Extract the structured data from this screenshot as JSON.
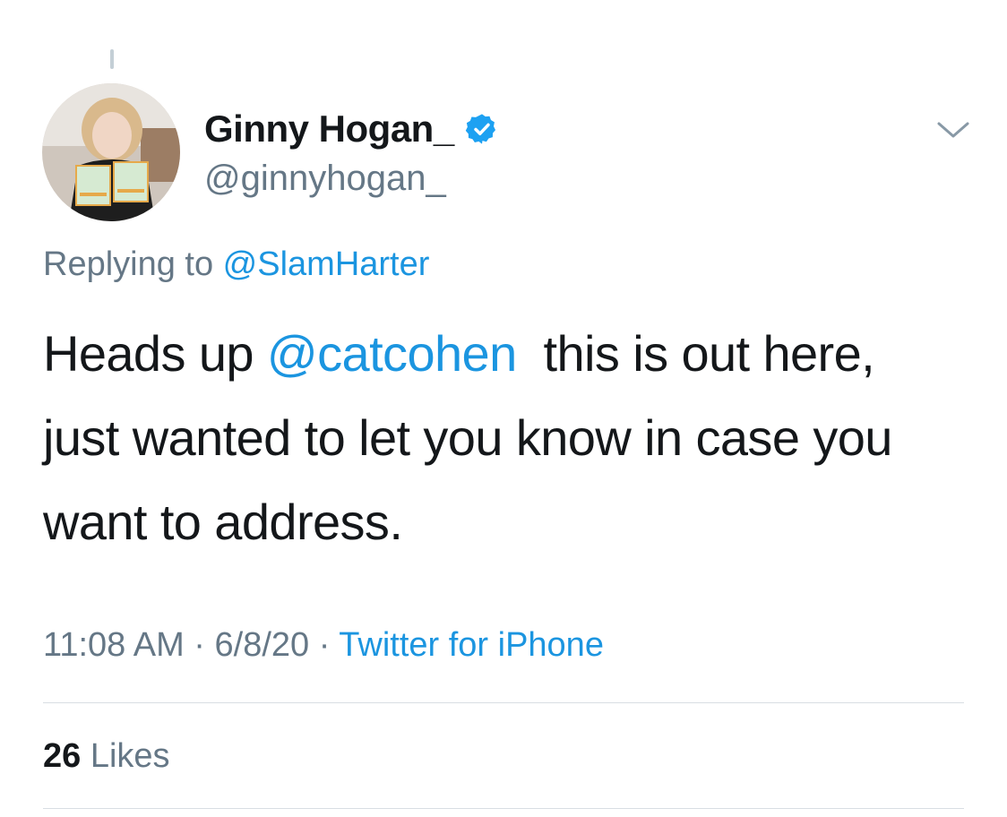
{
  "tweet": {
    "author": {
      "display_name": "Ginny Hogan_",
      "handle": "@ginnyhogan_",
      "verified": true
    },
    "reply": {
      "prefix": "Replying to ",
      "mention": "@SlamHarter"
    },
    "body": {
      "part1": "Heads up ",
      "mention": "@catcohen",
      "part2": "  this is out here, just wanted to let you know in case you want to address."
    },
    "meta": {
      "time": "11:08 AM",
      "separator1": " · ",
      "date": "6/8/20",
      "separator2": " · ",
      "source": "Twitter for iPhone"
    },
    "stats": {
      "likes_count": "26",
      "likes_label": " Likes"
    }
  },
  "icons": {
    "verified": "verified-badge-icon",
    "menu": "chevron-down-icon"
  },
  "colors": {
    "link": "#1b95e0",
    "secondary_text": "#657786",
    "primary_text": "#14171a",
    "verified": "#1da1f2",
    "divider": "#d8dee3"
  }
}
